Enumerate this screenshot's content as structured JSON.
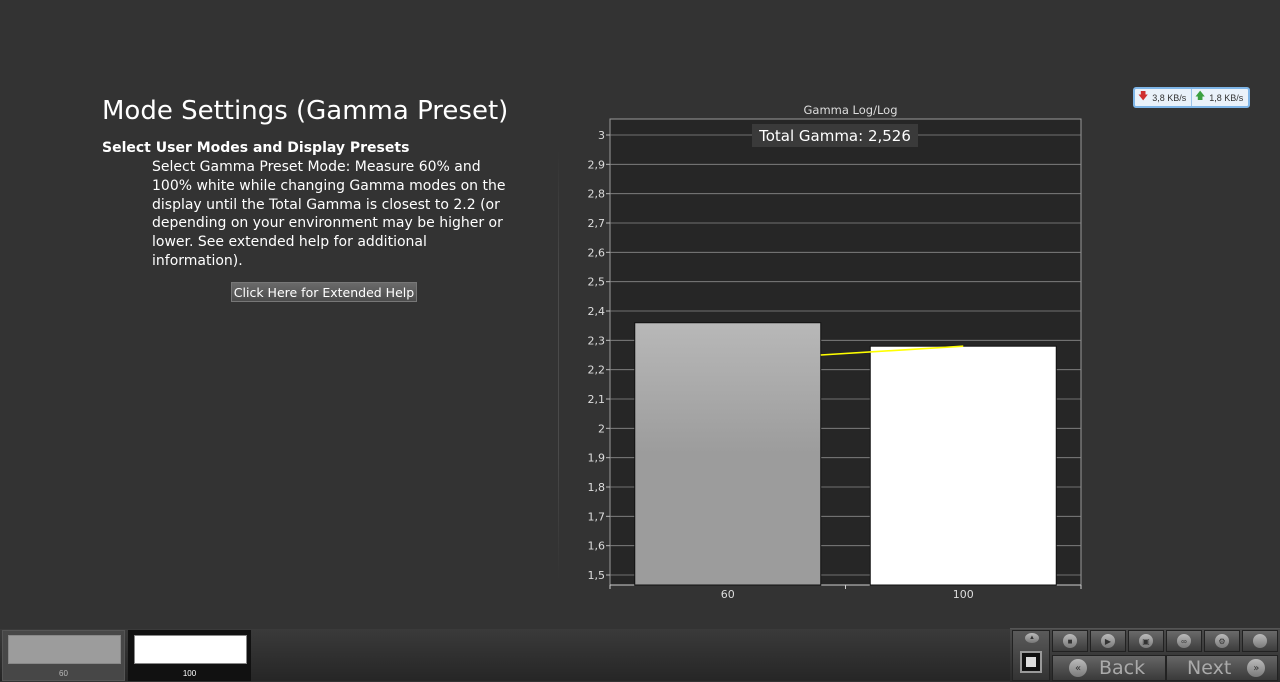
{
  "page": {
    "title": "Mode Settings (Gamma Preset)",
    "subtitle": "Select User Modes and Display Presets",
    "description": "Select Gamma Preset Mode: Measure 60% and 100% white while changing Gamma modes on the display until the Total Gamma is closest to 2.2 (or depending on your environment may be higher or lower. See extended help for additional information).",
    "help_button": "Click Here for Extended Help"
  },
  "network": {
    "download": "3,8 KB/s",
    "upload": "1,8 KB/s"
  },
  "chart_data": {
    "type": "bar",
    "title": "Gamma Log/Log",
    "annotation": "Total Gamma: 2,526",
    "categories": [
      "60",
      "100"
    ],
    "values": [
      2.36,
      2.28
    ],
    "bar_colors": [
      "#a4a4a4",
      "#ffffff"
    ],
    "line": {
      "x": [
        "60",
        "100"
      ],
      "y": [
        2.25,
        2.28
      ],
      "color": "#ffff00"
    },
    "ylim": [
      1.5,
      3.0
    ],
    "yticks": [
      "1,5",
      "1,6",
      "1,7",
      "1,8",
      "1,9",
      "2",
      "2,1",
      "2,2",
      "2,3",
      "2,4",
      "2,5",
      "2,6",
      "2,7",
      "2,8",
      "2,9",
      "3"
    ],
    "grid": true,
    "plot_background": "#262626"
  },
  "swatches": [
    {
      "label": "60",
      "color": "#9c9c9c",
      "selected": false
    },
    {
      "label": "100",
      "color": "#ffffff",
      "selected": true
    }
  ],
  "controls": {
    "back": "Back",
    "next": "Next",
    "icons": [
      "stop-icon",
      "play-icon",
      "save-icon",
      "continuous-icon",
      "settings-icon",
      "power-icon"
    ]
  }
}
